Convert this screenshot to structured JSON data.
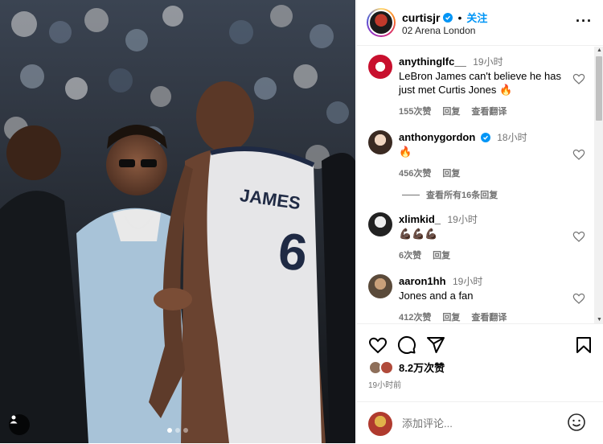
{
  "post": {
    "username": "curtisjr",
    "follow_label": "关注",
    "location": "02 Arena London",
    "separator": "•"
  },
  "photo": {
    "jersey_name": "JAMES",
    "jersey_number": "6"
  },
  "comments": [
    {
      "username": "anythinglfc__",
      "time": "19小时",
      "text": "LeBron James can't believe he has just met Curtis Jones 🔥",
      "likes": "155次赞",
      "reply": "回复",
      "translate": "查看翻译"
    },
    {
      "username": "anthonygordon",
      "time": "18小时",
      "text": "🔥",
      "likes": "456次赞",
      "reply": "回复",
      "translate": ""
    },
    {
      "username": "xlimkid_",
      "time": "19小时",
      "text": "💪🏿💪🏿💪🏿",
      "likes": "6次赞",
      "reply": "回复",
      "translate": ""
    },
    {
      "username": "aaron1hh",
      "time": "19小时",
      "text": "Jones and a fan",
      "likes": "412次赞",
      "reply": "回复",
      "translate": "查看翻译"
    }
  ],
  "view_all_replies": "查看所有16条回复",
  "likes_total": "8.2万次赞",
  "post_time": "19小时前",
  "add_comment_placeholder": "添加评论...",
  "colors": {
    "accent": "#0095f6",
    "muted": "#737373",
    "divider": "#efefef"
  },
  "icons": [
    "more-icon",
    "verified-icon",
    "heart-icon",
    "comment-icon",
    "share-icon",
    "bookmark-icon",
    "emoji-icon",
    "user-tag-icon"
  ]
}
